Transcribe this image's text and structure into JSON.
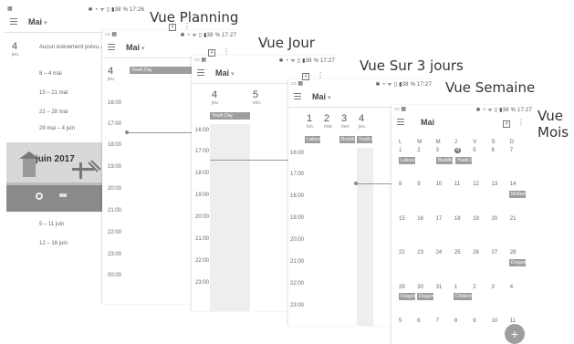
{
  "labels": {
    "planning": "Vue Planning",
    "jour": "Vue Jour",
    "sur3": "Vue Sur 3 jours",
    "semaine": "Vue Semaine",
    "mois_line1": "Vue",
    "mois_line2": "Mois"
  },
  "status": {
    "planning": "38 % 17:26",
    "other": "38 % 17:27"
  },
  "planning": {
    "month": "Mai",
    "day_num": "4",
    "day_label": "jeu.",
    "no_event": "Aucun événement prévu. A",
    "weeks": [
      "8 – 4 mai",
      "15 – 21 mai",
      "22 – 28 mai",
      "29 mai – 4 juin"
    ],
    "banner": "juin 2017",
    "weeks2": [
      "5 – 11 juin",
      "12 – 18 juin"
    ]
  },
  "day_view": {
    "month": "Mai",
    "day_num": "4",
    "day_label": "jeu.",
    "event": "Youth Day",
    "hours": [
      "16:00",
      "17:00",
      "18:00",
      "19:00",
      "20:00",
      "21:00",
      "22:00",
      "23:00",
      "00:00"
    ]
  },
  "jour_view": {
    "month": "Mai",
    "days": [
      {
        "num": "4",
        "lbl": "jeu."
      },
      {
        "num": "5",
        "lbl": "ven."
      }
    ],
    "event": "Youth Day",
    "hours": [
      "16:00",
      "17:00",
      "18:00",
      "19:00",
      "20:00",
      "21:00",
      "22:00",
      "23:00"
    ]
  },
  "three_day": {
    "month": "Mai",
    "days": [
      {
        "num": "1",
        "lbl": "lun."
      },
      {
        "num": "2",
        "lbl": "mar."
      },
      {
        "num": "3",
        "lbl": "mer."
      },
      {
        "num": "4",
        "lbl": "jeu."
      }
    ],
    "events": [
      "Labour D",
      "Buddha",
      "Youth D"
    ],
    "hours": [
      "16:00",
      "17:00",
      "18:00",
      "19:00",
      "20:00",
      "21:00",
      "22:00",
      "23:00"
    ]
  },
  "month_view": {
    "month": "Mai",
    "weekday_headers": [
      "L",
      "M",
      "M",
      "J",
      "V",
      "S",
      "D"
    ],
    "rows": [
      [
        "1",
        "2",
        "3",
        "4",
        "5",
        "6",
        "7"
      ],
      [
        "8",
        "9",
        "10",
        "11",
        "12",
        "13",
        "14"
      ],
      [
        "15",
        "16",
        "17",
        "18",
        "19",
        "20",
        "21"
      ],
      [
        "22",
        "23",
        "24",
        "25",
        "26",
        "27",
        "28"
      ],
      [
        "29",
        "30",
        "31",
        "1",
        "2",
        "3",
        "4"
      ],
      [
        "5",
        "6",
        "7",
        "8",
        "9",
        "10",
        "11"
      ]
    ],
    "events": {
      "labour": "Labour Da",
      "buddha": "Buddha's",
      "youth": "Youth Da",
      "mothers": "Mother's",
      "dragon1": "Dragon B",
      "dragon2": "Dragon B",
      "dragon3": "Dragon B",
      "dragon4": "Dragon B",
      "children": "Children's"
    },
    "fab": "+"
  },
  "colors": {
    "event": "#9e9e9e",
    "accent": "#888888"
  }
}
